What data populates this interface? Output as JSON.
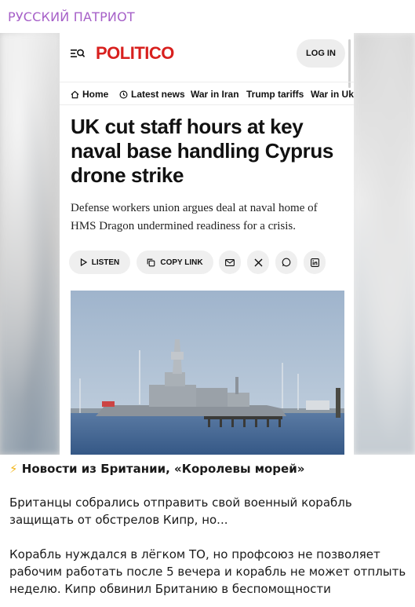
{
  "channel": {
    "name": "РУССКИЙ ПАТРИОТ"
  },
  "screenshot": {
    "brand": "POLITICO",
    "login_label": "LOG IN",
    "nav": [
      "Home",
      "Latest news",
      "War in Iran",
      "Trump tariffs",
      "War in Uk"
    ],
    "headline_lines": [
      "UK cut staff hours at key",
      "naval base handling Cyprus",
      "drone strike"
    ],
    "dek_lines": [
      "Defense workers union argues deal at naval home of",
      "HMS Dragon undermined readiness for a crisis."
    ],
    "share": {
      "listen_label": "LISTEN",
      "copy_link_label": "COPY LINK"
    },
    "icons": [
      "menu-search-icon",
      "home-icon",
      "clock-icon",
      "play-icon",
      "copy-icon",
      "mail-icon",
      "x-icon",
      "whatsapp-icon",
      "linkedin-icon"
    ],
    "brand_color": "#d8201e"
  },
  "post": {
    "bolt": "⚡",
    "title": "Новости из Британии, «Королевы морей»",
    "paragraph1": [
      "Британцы собрались отправить свой военный корабль",
      "защищать от обстрелов Кипр, но..."
    ],
    "paragraph2": [
      "Корабль нуждался в лёгком ТО, но профсоюз не позволяет",
      "рабочим работать после 5 вечера и корабль не может отплыть",
      "неделю. Кипр обвинил Британию в беспомощности"
    ]
  },
  "colors": {
    "channel_name": "#a660c8",
    "text": "#1a1a1a",
    "bolt": "#f2b61b"
  }
}
